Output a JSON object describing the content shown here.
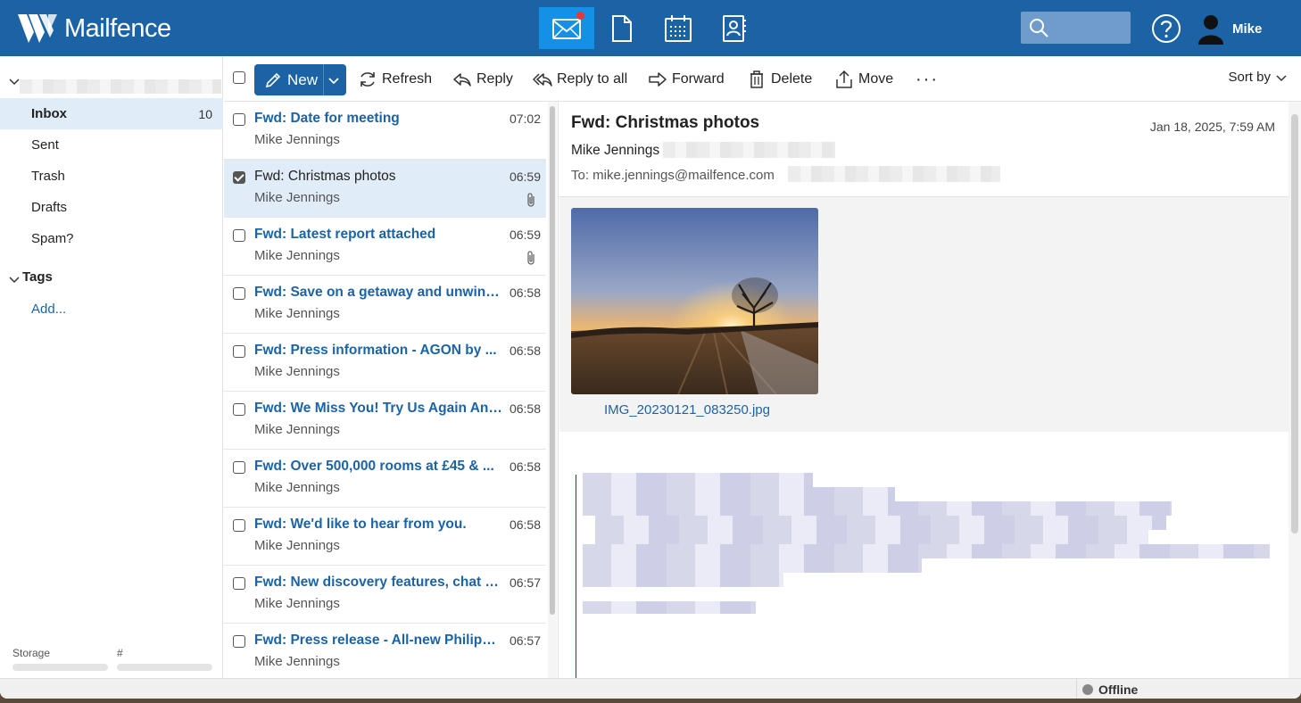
{
  "app": {
    "name": "Mailfence",
    "user": "Mike"
  },
  "colors": {
    "brand": "#1c63a6",
    "active_app": "#1491e6",
    "notification": "#e53935",
    "selected_row": "#e0ecf8"
  },
  "header": {
    "apps": [
      {
        "name": "mail",
        "icon": "envelope-icon",
        "active": true,
        "notification": true
      },
      {
        "name": "documents",
        "icon": "document-icon",
        "active": false
      },
      {
        "name": "calendar",
        "icon": "calendar-icon",
        "active": false
      },
      {
        "name": "contacts",
        "icon": "contacts-icon",
        "active": false
      }
    ],
    "search_icon": "search-icon",
    "help_icon": "help-icon",
    "user_icon": "user-silhouette-icon"
  },
  "sidebar": {
    "folders": [
      {
        "label": "Inbox",
        "count": "10",
        "active": true
      },
      {
        "label": "Sent"
      },
      {
        "label": "Trash"
      },
      {
        "label": "Drafts"
      },
      {
        "label": "Spam?"
      }
    ],
    "tags_label": "Tags",
    "tags_add": "Add...",
    "storage_label": "Storage",
    "hash_label": "#"
  },
  "toolbar": {
    "new_label": "New",
    "refresh_label": "Refresh",
    "reply_label": "Reply",
    "reply_all_label": "Reply to all",
    "forward_label": "Forward",
    "delete_label": "Delete",
    "move_label": "Move",
    "more_label": "···",
    "sort_label": "Sort by"
  },
  "messages": [
    {
      "subject": "Fwd: Date for meeting",
      "from": "Mike Jennings",
      "time": "07:02",
      "unread": true,
      "selected": false,
      "attachment": false
    },
    {
      "subject": "Fwd: Christmas photos",
      "from": "Mike Jennings",
      "time": "06:59",
      "unread": false,
      "selected": true,
      "attachment": true
    },
    {
      "subject": "Fwd: Latest report attached",
      "from": "Mike Jennings",
      "time": "06:59",
      "unread": true,
      "selected": false,
      "attachment": true
    },
    {
      "subject": "Fwd: Save on a getaway and unwind...",
      "from": "Mike Jennings",
      "time": "06:58",
      "unread": true,
      "selected": false,
      "attachment": false
    },
    {
      "subject": "Fwd: Press information - AGON by ...",
      "from": "Mike Jennings",
      "time": "06:58",
      "unread": true,
      "selected": false,
      "attachment": false
    },
    {
      "subject": "Fwd: We Miss You! Try Us Again And...",
      "from": "Mike Jennings",
      "time": "06:58",
      "unread": true,
      "selected": false,
      "attachment": false
    },
    {
      "subject": "Fwd: Over 500,000 rooms at £45 & ...",
      "from": "Mike Jennings",
      "time": "06:58",
      "unread": true,
      "selected": false,
      "attachment": false
    },
    {
      "subject": "Fwd: We'd like to hear from you.",
      "from": "Mike Jennings",
      "time": "06:58",
      "unread": true,
      "selected": false,
      "attachment": false
    },
    {
      "subject": "Fwd: New discovery features, chat p...",
      "from": "Mike Jennings",
      "time": "06:57",
      "unread": true,
      "selected": false,
      "attachment": false
    },
    {
      "subject": "Fwd: Press release - All-new Philips ...",
      "from": "Mike Jennings",
      "time": "06:57",
      "unread": true,
      "selected": false,
      "attachment": false
    }
  ],
  "reader": {
    "subject": "Fwd: Christmas photos",
    "date": "Jan 18, 2025, 7:59 AM",
    "from": "Mike Jennings",
    "to": "To: mike.jennings@mailfence.com",
    "attachment_name": "IMG_20230121_083250.jpg"
  },
  "status": {
    "label": "Offline"
  }
}
